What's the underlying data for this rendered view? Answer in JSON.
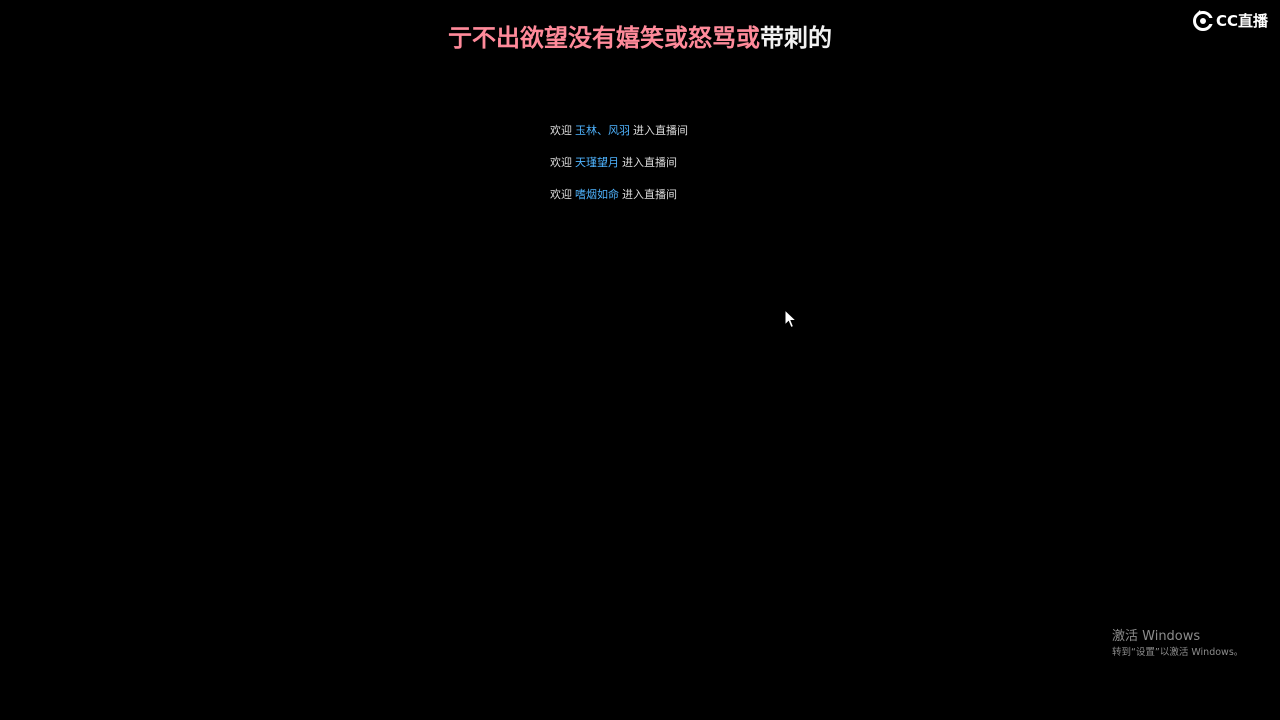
{
  "lyric": {
    "sung": "亍不出欲望没有嬉笑或怒骂或",
    "unsung": "带刺的",
    "sung_color": "#ff8a9a",
    "unsung_color": "#f2f2f2"
  },
  "logo": {
    "text": "CC直播",
    "icon": "cc-logo-icon"
  },
  "welcome_messages": [
    {
      "prefix": "欢迎",
      "user": "玉林、风羽",
      "suffix": "进入直播间"
    },
    {
      "prefix": "欢迎",
      "user": "天瑾望月",
      "suffix": "进入直播间"
    },
    {
      "prefix": "欢迎",
      "user": "嗜烟如命",
      "suffix": "进入直播间"
    }
  ],
  "username_color": "#4fb4ff",
  "cursor": {
    "icon": "mouse-pointer-icon"
  },
  "activation": {
    "title": "激活 Windows",
    "subtitle": "转到“设置”以激活 Windows。"
  }
}
